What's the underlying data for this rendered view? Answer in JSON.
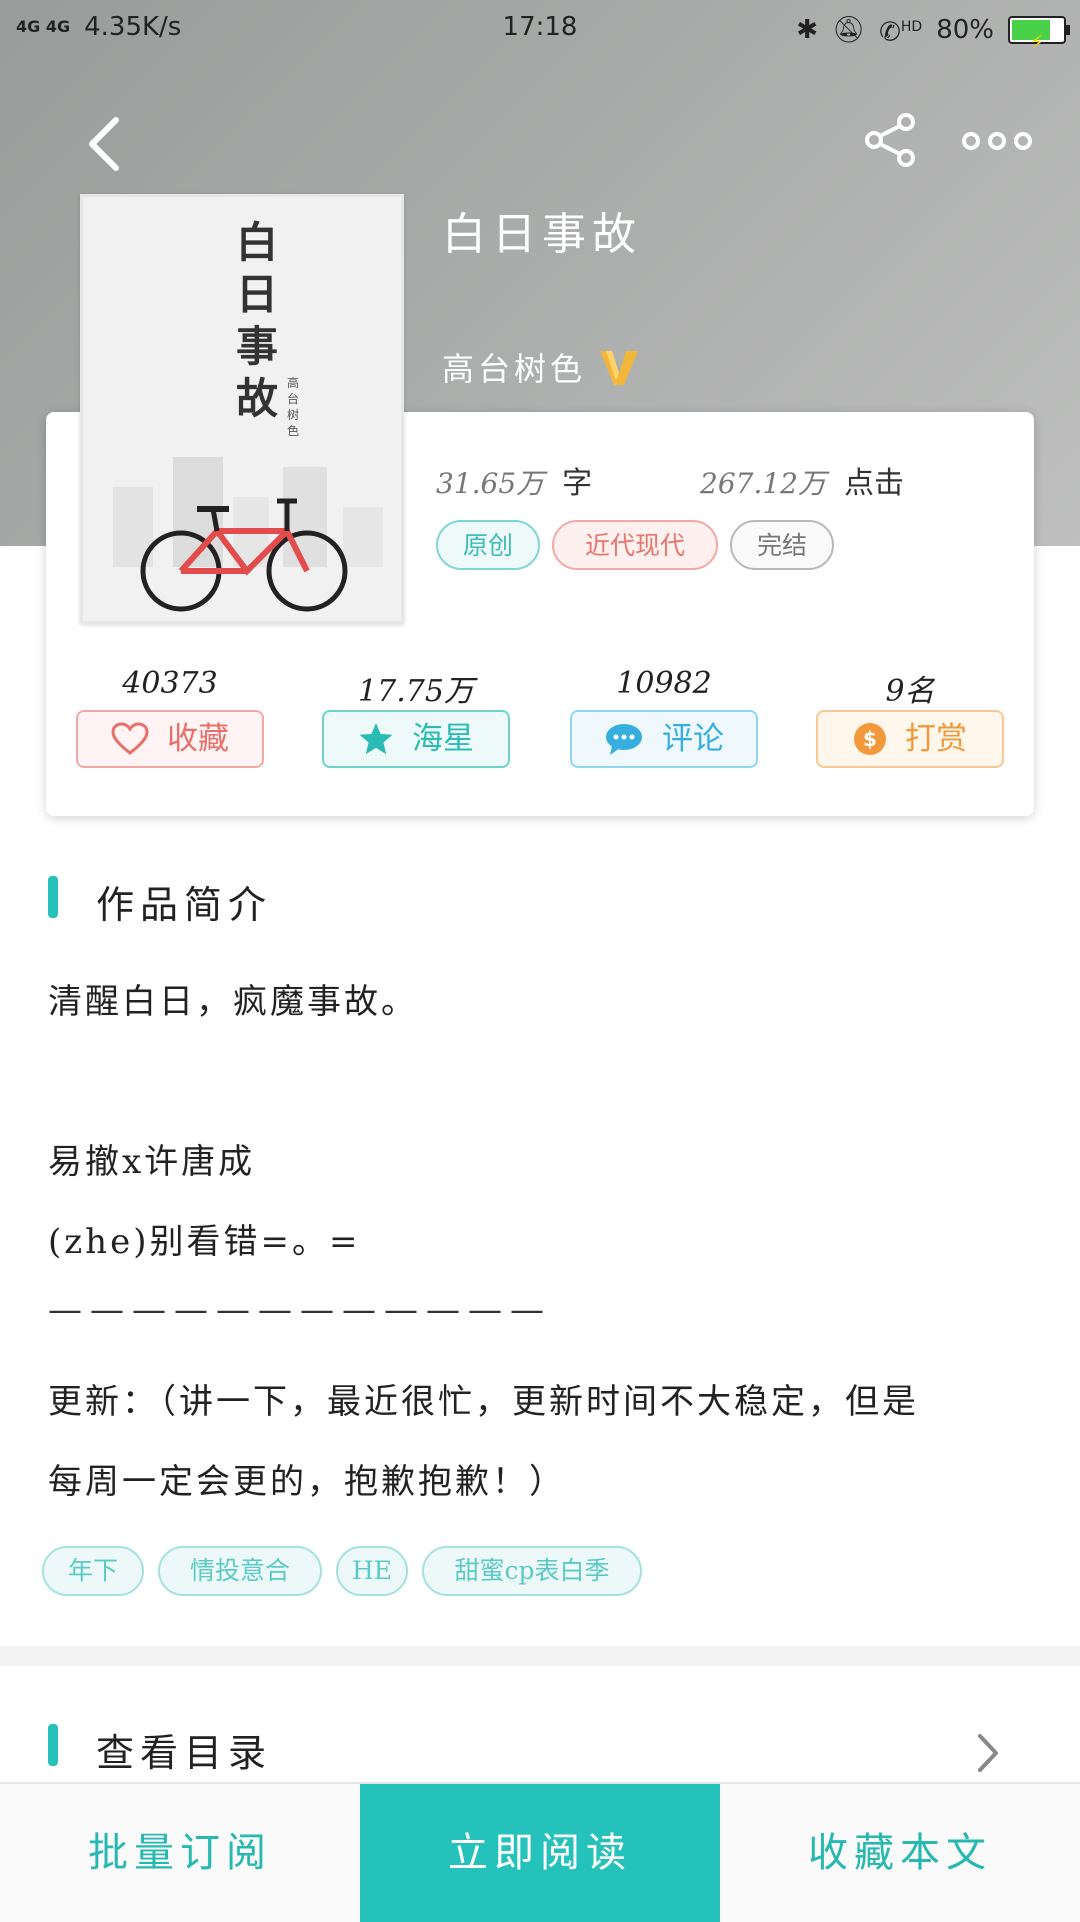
{
  "status_bar": {
    "network": "4G 4G",
    "speed": "4.35K/s",
    "time": "17:18",
    "hd": "HD",
    "battery": "80%"
  },
  "book": {
    "title": "白日事故",
    "author": "高台树色",
    "cover_title": "白日事故",
    "cover_author": "高台树色",
    "word_count_value": "31.65万",
    "word_count_label": "字",
    "clicks_value": "267.12万",
    "clicks_label": "点击",
    "tags": [
      "原创",
      "近代现代",
      "完结"
    ]
  },
  "metrics": [
    {
      "value": "40373",
      "label": "收藏",
      "icon": "heart-icon"
    },
    {
      "value": "17.75万",
      "label": "海星",
      "icon": "star-icon"
    },
    {
      "value": "10982",
      "label": "评论",
      "icon": "comment-icon"
    },
    {
      "value": "9名",
      "label": "打赏",
      "icon": "coin-icon"
    }
  ],
  "intro": {
    "heading": "作品简介",
    "lines": [
      "清醒白日，疯魔事故。",
      "易撤x许唐成",
      "(zhe)别看错=。=",
      "————————————",
      "更新：（讲一下，最近很忙，更新时间不大稳定，但是",
      "每周一定会更的，抱歉抱歉！）"
    ],
    "keywords": [
      "年下",
      "情投意合",
      "HE",
      "甜蜜cp表白季"
    ]
  },
  "toc": {
    "heading": "查看目录"
  },
  "bottom_bar": {
    "batch_subscribe": "批量订阅",
    "read_now": "立即阅读",
    "add_to_shelf": "收藏本文"
  },
  "colors": {
    "accent": "#25c2bc",
    "heart": "#e8706b",
    "comment": "#36aee0",
    "tip": "#f29a3b"
  }
}
